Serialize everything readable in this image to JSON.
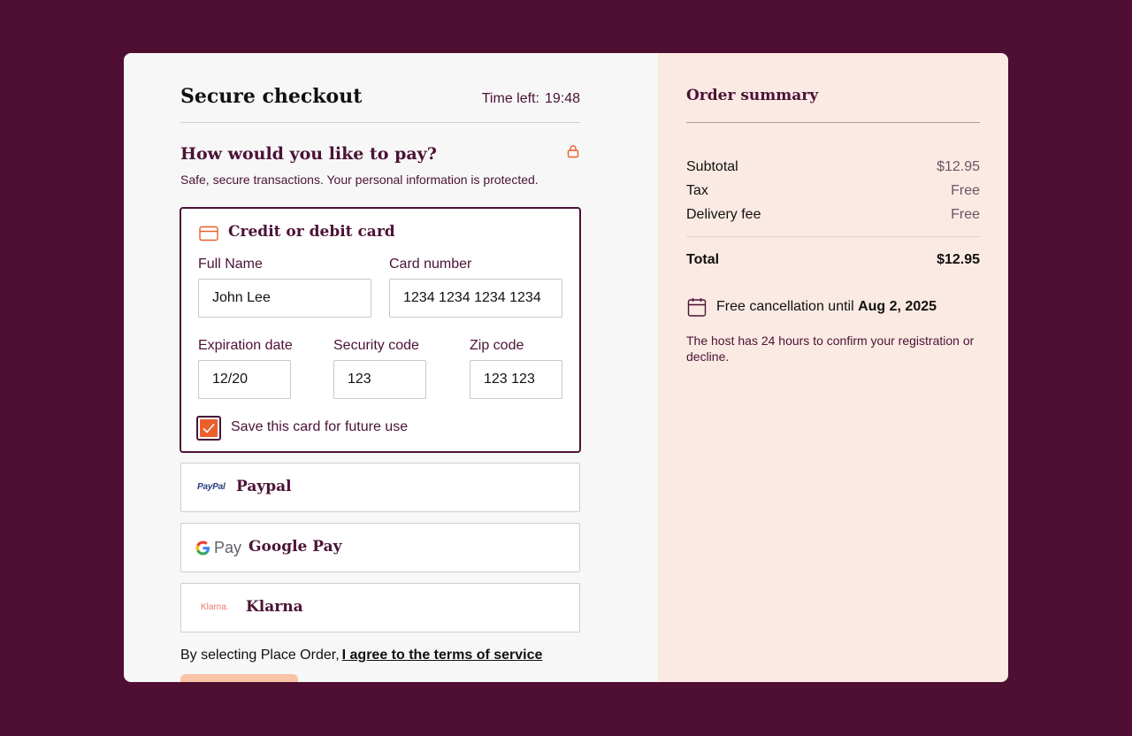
{
  "checkout": {
    "title": "Secure checkout",
    "timer_label": "Time left:",
    "timer_value": "19:48",
    "question": "How would you like to pay?",
    "subtitle": "Safe, secure transactions. Your personal information is protected."
  },
  "card": {
    "title": "Credit or debit card",
    "full_name_label": "Full Name",
    "full_name_value": "John Lee",
    "card_number_label": "Card number",
    "card_number_value": "1234 1234 1234 1234",
    "expiration_label": "Expiration date",
    "expiration_value": "12/20",
    "security_label": "Security code",
    "security_value": "123",
    "zip_label": "Zip code",
    "zip_value": "123 123",
    "save_label": "Save this card for future use",
    "save_checked": true
  },
  "options": {
    "paypal_logo": "PayPal",
    "paypal_label": "Paypal",
    "gpay_logo": "Pay",
    "gpay_label": "Google Pay",
    "klarna_logo": "Klarna.",
    "klarna_label": "Klarna"
  },
  "terms": {
    "prefix": "By selecting Place Order,",
    "link": "I agree to the terms of service"
  },
  "summary": {
    "title": "Order summary",
    "subtotal_label": "Subtotal",
    "subtotal_value": "$12.95",
    "tax_label": "Tax",
    "tax_value": "Free",
    "delivery_label": "Delivery fee",
    "delivery_value": "Free",
    "total_label": "Total",
    "total_value": "$12.95",
    "cancel_prefix": "Free cancellation until",
    "cancel_date": "Aug 2, 2025",
    "host_note": "The host has 24 hours to confirm your registration or decline."
  },
  "colors": {
    "background": "#4f0f32",
    "accent": "#ea5f2b",
    "brand": "#4b1236",
    "summary_bg": "#fbeae3"
  },
  "icons": [
    "lock-icon",
    "credit-card-icon",
    "checkmark-icon",
    "paypal-logo",
    "google-g-icon",
    "klarna-logo",
    "calendar-icon"
  ]
}
